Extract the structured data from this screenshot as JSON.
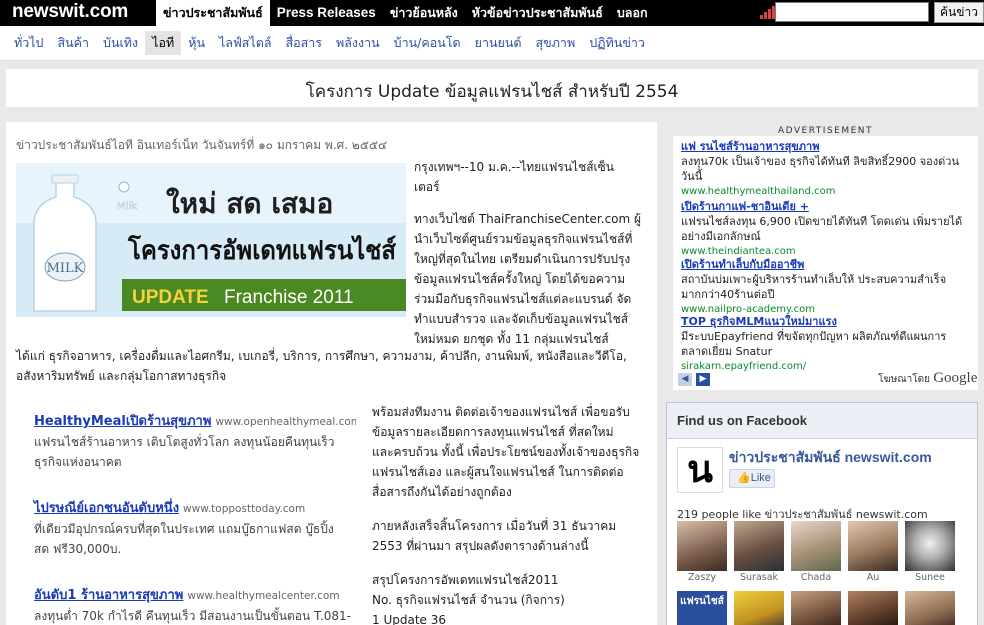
{
  "topbar": {
    "logo": "newswit.com",
    "nav": [
      {
        "label": "ข่าวประชาสัมพันธ์",
        "active": true
      },
      {
        "label": "Press Releases",
        "active": false
      },
      {
        "label": "ข่าวย้อนหลัง",
        "active": false
      },
      {
        "label": "หัวข้อข่าวประชาสัมพันธ์",
        "active": false
      },
      {
        "label": "บลอก",
        "active": false
      }
    ],
    "search_value": "",
    "search_button": "ค้นข่าว"
  },
  "categories": [
    {
      "label": "ทั่วไป",
      "active": false
    },
    {
      "label": "สินค้า",
      "active": false
    },
    {
      "label": "บันเทิง",
      "active": false
    },
    {
      "label": "ไอที",
      "active": true
    },
    {
      "label": "หุ้น",
      "active": false
    },
    {
      "label": "ไลฟ์สไตล์",
      "active": false
    },
    {
      "label": "สื่อสาร",
      "active": false
    },
    {
      "label": "พลังงาน",
      "active": false
    },
    {
      "label": "บ้าน/คอนโด",
      "active": false
    },
    {
      "label": "ยานยนต์",
      "active": false
    },
    {
      "label": "สุขภาพ",
      "active": false
    },
    {
      "label": "ปฏิทินข่าว",
      "active": false
    }
  ],
  "headline": "โครงการ Update ข้อมูลแฟรนไชส์ สำหรับปี 2554",
  "article": {
    "dateline": "ข่าวประชาสัมพันธ์ไอที อินเทอร์เน็ท วันจันทร์ที่ ๑๐ มกราคม พ.ศ. ๒๕๕๔",
    "banner": {
      "milk_label": "Milk",
      "bottle_label": "MILK",
      "top_text": "ใหม่ สด เสมอ",
      "main_text": "โครงการอัพเดทแฟรนไชส์",
      "sub_text_a": "UPDATE",
      "sub_text_b": "Franchise 2011"
    },
    "side_lines": [
      "กรุงเทพฯ--10 ม.ค.--ไทยแฟรนไชส์เซ็น",
      "เตอร์",
      "",
      "ทางเว็บไซต์ ThaiFranchiseCenter.com ผู้",
      "นำเว็บไซต์ศูนย์รวมข้อมูลธุรกิจแฟรนไชส์ที่",
      "ใหญ่ที่สุดในไทย เตรียมดำเนินการปรับปรุง",
      "ข้อมูลแฟรนไชส์ครั้งใหญ่ โดยได้ขอความ",
      "ร่วมมือกับธุรกิจแฟรนไชส์แต่ละแบรนด์ จัด",
      "ทำแบบสำรวจ และจัดเก็บข้อมูลแฟรนไชส์",
      "ใหม่หมด ยกชุด ทั้ง 11 กลุ่มแฟรนไชส์"
    ],
    "full_lines": [
      "ได้แก่ ธุรกิจอาหาร, เครื่องดื่มและไอศกรีม, เบเกอรี่, บริการ, การศึกษา, ความงาม, ค้าปลีก, งานพิมพ์, หนังสือและวีดีโอ,",
      "อสังหาริมทรัพย์ และกลุ่มโอกาสทางธุรกิจ"
    ],
    "right_lines": [
      "พร้อมส่งทีมงาน ติดต่อเจ้าของแฟรนไชส์ เพื่อขอรับ",
      "ข้อมูลรายละเอียดการลงทุนแฟรนไชส์ ที่สดใหม่",
      "และครบถ้วน ทั้งนี้ เพื่อประโยชน์ของทั้งเจ้าของธุรกิจ",
      "แฟรนไชส์เอง และผู้สนใจแฟรนไชส์ ในการติดต่อ",
      "สื่อสารถึงกันได้อย่างถูกต้อง",
      "",
      "ภายหลังเสร็จสิ้นโครงการ เมื่อวันที่ 31 ธันวาคม",
      "2553 ที่ผ่านมา สรุปผลดังตารางด้านล่างนี้",
      "",
      "สรุปโครงการอัพเดทแฟรนไชส์2011",
      "No. ธุรกิจแฟรนไชส์ จำนวน (กิจการ)",
      "1 Update 36"
    ],
    "ads": [
      {
        "title": "HealthyMealเปิดร้านสุขภาพ",
        "url": "www.openhealthymeal.com/sm",
        "desc": [
          "แฟรนไชส์ร้านอาหาร เติบโตสูงทั่วโลก ลงทุนน้อยคืนทุนเร็ว",
          "ธุรกิจแห่งอนาคต"
        ]
      },
      {
        "title": "ไปรษณีย์เอกชนอันดับหนึ่ง",
        "url": "www.topposttoday.com",
        "desc": [
          "ที่เดียวมีอุปกรณ์ครบที่สุดในประเทศ แถมบู๊ธกาแฟสด บู๊ธปิ้ง",
          "สด ฟรี30,000บ."
        ]
      },
      {
        "title": "อันดับ1 ร้านอาหารสุขภาพ",
        "url": "www.healthymealcenter.com",
        "desc": [
          "ลงทุนต่ำ 70k กำไรดี คืนทุนเร็ว มีสอนงานเป็นขั้นตอน T.081-"
        ]
      }
    ]
  },
  "sidebar": {
    "advertisement_label": "ADVERTISEMENT",
    "ads": [
      {
        "title": "แฟ รนไชส์ร้านอาหารสุขภาพ",
        "desc": [
          "ลงทุน70k เป็นเจ้าของ ธุรกิจได้ทันที ลิขสิทธิ์2900 จองด่วน",
          "วันนี้"
        ],
        "url": "www.healthymealthailand.com"
      },
      {
        "title": "เปิดร้านกาแฟ-ชาอินเดีย +",
        "desc": [
          "แฟรนไชส์ลงทุน 6,900 เปิดขายได้ทันที โดดเด่น เพิ่มรายได้",
          "อย่างมีเอกลักษณ์"
        ],
        "url": "www.theindiantea.com"
      },
      {
        "title": "เปิดร้านทำเล็บกับมืออาชีพ",
        "desc": [
          "สถาบันบ่มเพาะผู้บริหารร้านทำเล็บให้ ประสบความสำเร็จ",
          "มากกว่า40ร้านต่อปี"
        ],
        "url": "www.nailpro-academy.com"
      },
      {
        "title": "TOP ธุรกิจMLMแนวใหม่มาแรง",
        "desc": [
          "มีระบบEpayfriend ที่ขจัดทุกปัญหา ผลิตภัณฑ์ดีแผนการ",
          "ตลาดเยี่ยม Snatur"
        ],
        "url": "sirakarn.epayfriend.com/"
      }
    ],
    "ads_by_prefix": "โฆษณาโดย",
    "ads_by_brand": "Google",
    "facebook": {
      "header": "Find us on Facebook",
      "logo_glyph": "น",
      "page_name": "ข่าวประชาสัมพันธ์ newswit.com",
      "like_label": "Like",
      "like_count": "219 people like ข่าวประชาสัมพันธ์ newswit.com",
      "faces": [
        "Zaszy",
        "Surasak",
        "Chada",
        "Au",
        "Sunee"
      ],
      "second_row_first_label": "แฟรนไชส์"
    }
  }
}
